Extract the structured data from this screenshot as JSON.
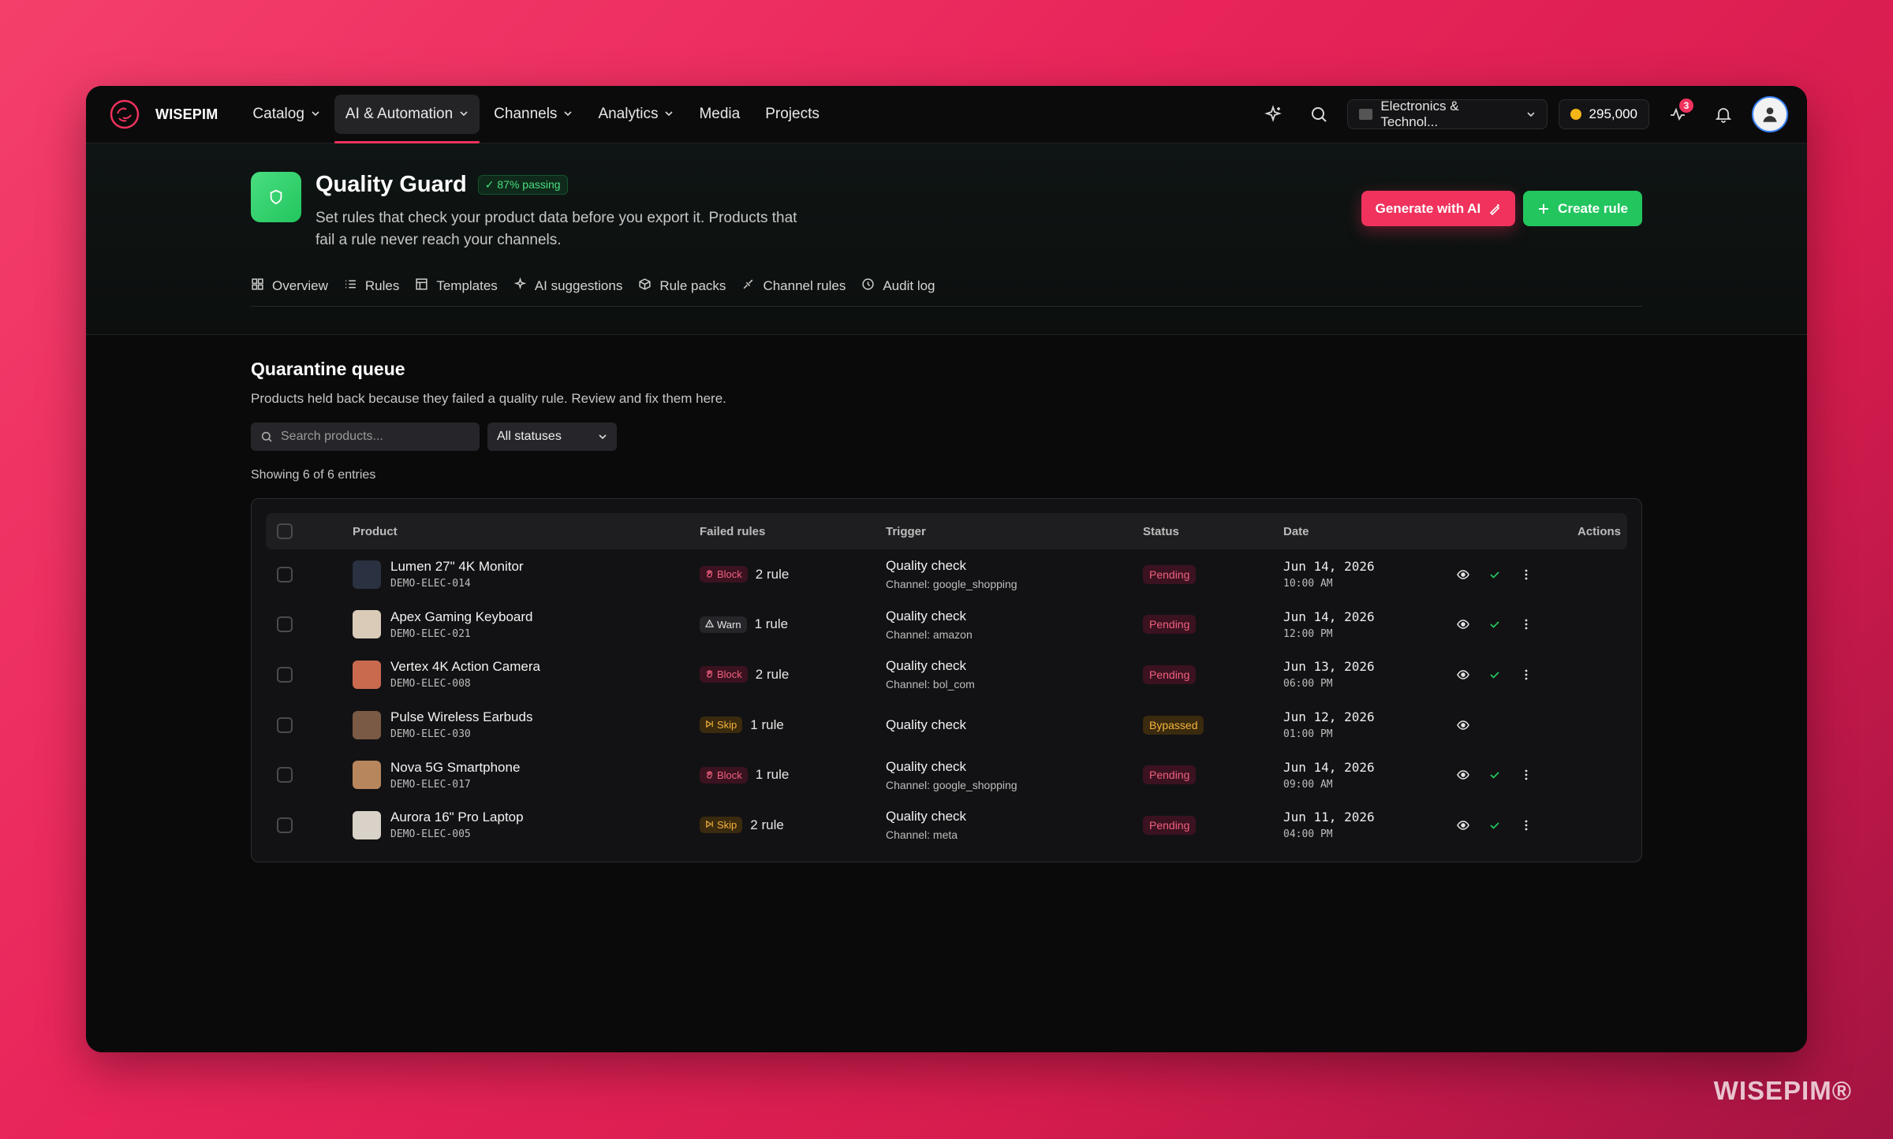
{
  "brand": {
    "logo_text": "WISEPIM",
    "watermark": "WISEPIM®"
  },
  "nav": {
    "items": [
      {
        "label": "Catalog",
        "dropdown": true,
        "active": false
      },
      {
        "label": "AI & Automation",
        "dropdown": true,
        "active": true
      },
      {
        "label": "Channels",
        "dropdown": true,
        "active": false
      },
      {
        "label": "Analytics",
        "dropdown": true,
        "active": false
      },
      {
        "label": "Media",
        "dropdown": false,
        "active": false
      },
      {
        "label": "Projects",
        "dropdown": false,
        "active": false
      }
    ],
    "workspace": "Electronics & Technol...",
    "credits": "295,000",
    "alerts_count": "3"
  },
  "header": {
    "title": "Quality Guard",
    "passing_badge": "87% passing",
    "description": "Set rules that check your product data before you export it. Products that fail a rule never reach your channels.",
    "generate_button": "Generate with AI",
    "create_button": "Create rule",
    "tabs": [
      "Overview",
      "Rules",
      "Templates",
      "AI suggestions",
      "Rule packs",
      "Channel rules",
      "Audit log"
    ]
  },
  "queue": {
    "title": "Quarantine queue",
    "subtitle": "Products held back because they failed a quality rule. Review and fix them here.",
    "search_placeholder": "Search products...",
    "status_filter": "All statuses",
    "count_text": "Showing 6 of 6 entries",
    "columns": {
      "product": "Product",
      "failed_rules": "Failed rules",
      "trigger": "Trigger",
      "status": "Status",
      "date": "Date",
      "actions": "Actions"
    },
    "rows": [
      {
        "name": "Lumen 27\" 4K Monitor",
        "sku": "DEMO-ELEC-014",
        "rule_type": "Block",
        "rule_count": "2 rule",
        "trigger": "Quality check",
        "channel": "Channel: google_shopping",
        "status": "Pending",
        "date": "Jun 14, 2026",
        "time": "10:00 AM",
        "thumb_color": "#2a3140"
      },
      {
        "name": "Apex Gaming Keyboard",
        "sku": "DEMO-ELEC-021",
        "rule_type": "Warn",
        "rule_count": "1 rule",
        "trigger": "Quality check",
        "channel": "Channel: amazon",
        "status": "Pending",
        "date": "Jun 14, 2026",
        "time": "12:00 PM",
        "thumb_color": "#d9cbb8"
      },
      {
        "name": "Vertex 4K Action Camera",
        "sku": "DEMO-ELEC-008",
        "rule_type": "Block",
        "rule_count": "2 rule",
        "trigger": "Quality check",
        "channel": "Channel: bol_com",
        "status": "Pending",
        "date": "Jun 13, 2026",
        "time": "06:00 PM",
        "thumb_color": "#c96a4e"
      },
      {
        "name": "Pulse Wireless Earbuds",
        "sku": "DEMO-ELEC-030",
        "rule_type": "Skip",
        "rule_count": "1 rule",
        "trigger": "Quality check",
        "channel": "",
        "status": "Bypassed",
        "date": "Jun 12, 2026",
        "time": "01:00 PM",
        "thumb_color": "#7a5a44"
      },
      {
        "name": "Nova 5G Smartphone",
        "sku": "DEMO-ELEC-017",
        "rule_type": "Block",
        "rule_count": "1 rule",
        "trigger": "Quality check",
        "channel": "Channel: google_shopping",
        "status": "Pending",
        "date": "Jun 14, 2026",
        "time": "09:00 AM",
        "thumb_color": "#b8865c"
      },
      {
        "name": "Aurora 16\" Pro Laptop",
        "sku": "DEMO-ELEC-005",
        "rule_type": "Skip",
        "rule_count": "2 rule",
        "trigger": "Quality check",
        "channel": "Channel: meta",
        "status": "Pending",
        "date": "Jun 11, 2026",
        "time": "04:00 PM",
        "thumb_color": "#d8d2c8"
      }
    ]
  },
  "colors": {
    "accent": "#f0325d",
    "success": "#22c55e",
    "background": "#0a0a0b"
  }
}
